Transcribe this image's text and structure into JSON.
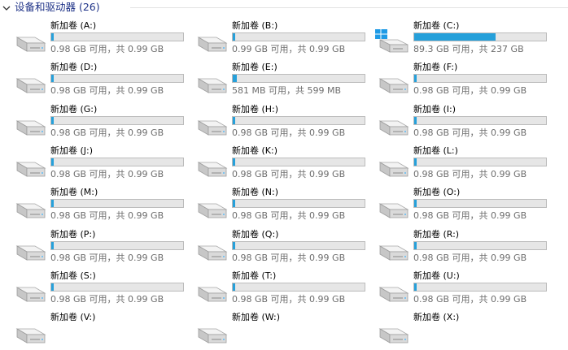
{
  "section": {
    "title": "设备和驱动器 (26)"
  },
  "colors": {
    "title": "#1e3287",
    "bar_fill": "#26a0da",
    "bar_bg": "#e6e6e6",
    "free_text": "#6d6d6d"
  },
  "drives": [
    {
      "name": "新加卷 (A:)",
      "free": "0.98 GB 可用，共 0.99 GB",
      "used_fraction": 0.01,
      "icon": "drive-icon"
    },
    {
      "name": "新加卷 (B:)",
      "free": "0.99 GB 可用，共 0.99 GB",
      "used_fraction": 0.0,
      "icon": "drive-icon"
    },
    {
      "name": "新加卷 (C:)",
      "free": "89.3 GB 可用，共 237 GB",
      "used_fraction": 0.62,
      "icon": "windows-drive-icon"
    },
    {
      "name": "新加卷 (D:)",
      "free": "0.98 GB 可用，共 0.99 GB",
      "used_fraction": 0.01,
      "icon": "drive-icon"
    },
    {
      "name": "新加卷 (E:)",
      "free": "581 MB 可用，共 599 MB",
      "used_fraction": 0.03,
      "icon": "drive-icon"
    },
    {
      "name": "新加卷 (F:)",
      "free": "0.98 GB 可用，共 0.99 GB",
      "used_fraction": 0.01,
      "icon": "drive-icon"
    },
    {
      "name": "新加卷 (G:)",
      "free": "0.98 GB 可用，共 0.99 GB",
      "used_fraction": 0.01,
      "icon": "drive-icon"
    },
    {
      "name": "新加卷 (H:)",
      "free": "0.98 GB 可用，共 0.99 GB",
      "used_fraction": 0.01,
      "icon": "drive-icon"
    },
    {
      "name": "新加卷 (I:)",
      "free": "0.98 GB 可用，共 0.99 GB",
      "used_fraction": 0.01,
      "icon": "drive-icon"
    },
    {
      "name": "新加卷 (J:)",
      "free": "0.98 GB 可用，共 0.99 GB",
      "used_fraction": 0.01,
      "icon": "drive-icon"
    },
    {
      "name": "新加卷 (K:)",
      "free": "0.98 GB 可用，共 0.99 GB",
      "used_fraction": 0.01,
      "icon": "drive-icon"
    },
    {
      "name": "新加卷 (L:)",
      "free": "0.98 GB 可用，共 0.99 GB",
      "used_fraction": 0.01,
      "icon": "drive-icon"
    },
    {
      "name": "新加卷 (M:)",
      "free": "0.98 GB 可用，共 0.99 GB",
      "used_fraction": 0.01,
      "icon": "drive-icon"
    },
    {
      "name": "新加卷 (N:)",
      "free": "0.98 GB 可用，共 0.99 GB",
      "used_fraction": 0.01,
      "icon": "drive-icon"
    },
    {
      "name": "新加卷 (O:)",
      "free": "0.98 GB 可用，共 0.99 GB",
      "used_fraction": 0.01,
      "icon": "drive-icon"
    },
    {
      "name": "新加卷 (P:)",
      "free": "0.98 GB 可用，共 0.99 GB",
      "used_fraction": 0.01,
      "icon": "drive-icon"
    },
    {
      "name": "新加卷 (Q:)",
      "free": "0.98 GB 可用，共 0.99 GB",
      "used_fraction": 0.01,
      "icon": "drive-icon"
    },
    {
      "name": "新加卷 (R:)",
      "free": "0.98 GB 可用，共 0.99 GB",
      "used_fraction": 0.01,
      "icon": "drive-icon"
    },
    {
      "name": "新加卷 (S:)",
      "free": "0.98 GB 可用，共 0.99 GB",
      "used_fraction": 0.01,
      "icon": "drive-icon"
    },
    {
      "name": "新加卷 (T:)",
      "free": "0.98 GB 可用，共 0.99 GB",
      "used_fraction": 0.01,
      "icon": "drive-icon"
    },
    {
      "name": "新加卷 (U:)",
      "free": "0.98 GB 可用，共 0.99 GB",
      "used_fraction": 0.01,
      "icon": "drive-icon"
    },
    {
      "name": "新加卷 (V:)",
      "free": "",
      "used_fraction": null,
      "icon": "drive-icon"
    },
    {
      "name": "新加卷 (W:)",
      "free": "",
      "used_fraction": null,
      "icon": "drive-icon"
    },
    {
      "name": "新加卷 (X:)",
      "free": "",
      "used_fraction": null,
      "icon": "drive-icon"
    }
  ]
}
